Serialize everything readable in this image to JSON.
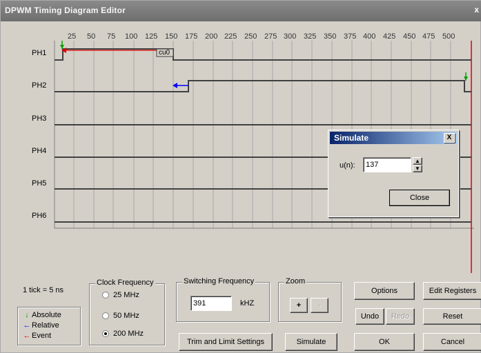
{
  "window": {
    "title": "DPWM Timing Diagram Editor",
    "close_glyph": "x"
  },
  "diagram": {
    "ticks": [
      "25",
      "50",
      "75",
      "100",
      "125",
      "150",
      "175",
      "200",
      "225",
      "250",
      "275",
      "300",
      "325",
      "350",
      "375",
      "400",
      "425",
      "450",
      "475",
      "500"
    ],
    "phases": [
      "PH1",
      "PH2",
      "PH3",
      "PH4",
      "PH5",
      "PH6"
    ],
    "cursor_label": "cu0"
  },
  "simulate_dialog": {
    "title": "Simulate",
    "close_glyph": "X",
    "field_label": "u(n):",
    "field_value": "137",
    "close_button": "Close"
  },
  "tick_info": "1 tick = 5 ns",
  "legend": {
    "items": [
      {
        "label": "Absolute",
        "color": "#00a000"
      },
      {
        "label": "Relative",
        "color": "#0000ff"
      },
      {
        "label": "Event",
        "color": "#e00000"
      }
    ]
  },
  "clock_frequency": {
    "legend": "Clock Frequency",
    "options": [
      {
        "label": "25 MHz",
        "selected": false
      },
      {
        "label": "50 MHz",
        "selected": false
      },
      {
        "label": "200 MHz",
        "selected": true
      }
    ]
  },
  "switching_frequency": {
    "legend": "Switching Frequency",
    "value": "391",
    "unit": "kHZ"
  },
  "zoom": {
    "legend": "Zoom",
    "plus": "+",
    "minus": "-"
  },
  "buttons": {
    "trim": "Trim and Limit Settings",
    "simulate": "Simulate",
    "options": "Options",
    "edit_registers": "Edit Registers",
    "undo": "Undo",
    "redo": "Redo",
    "reset": "Reset",
    "ok": "OK",
    "cancel": "Cancel"
  },
  "colors": {
    "absolute": "#00a000",
    "relative": "#0000ff",
    "event": "#e00000",
    "signal": "#404040"
  }
}
